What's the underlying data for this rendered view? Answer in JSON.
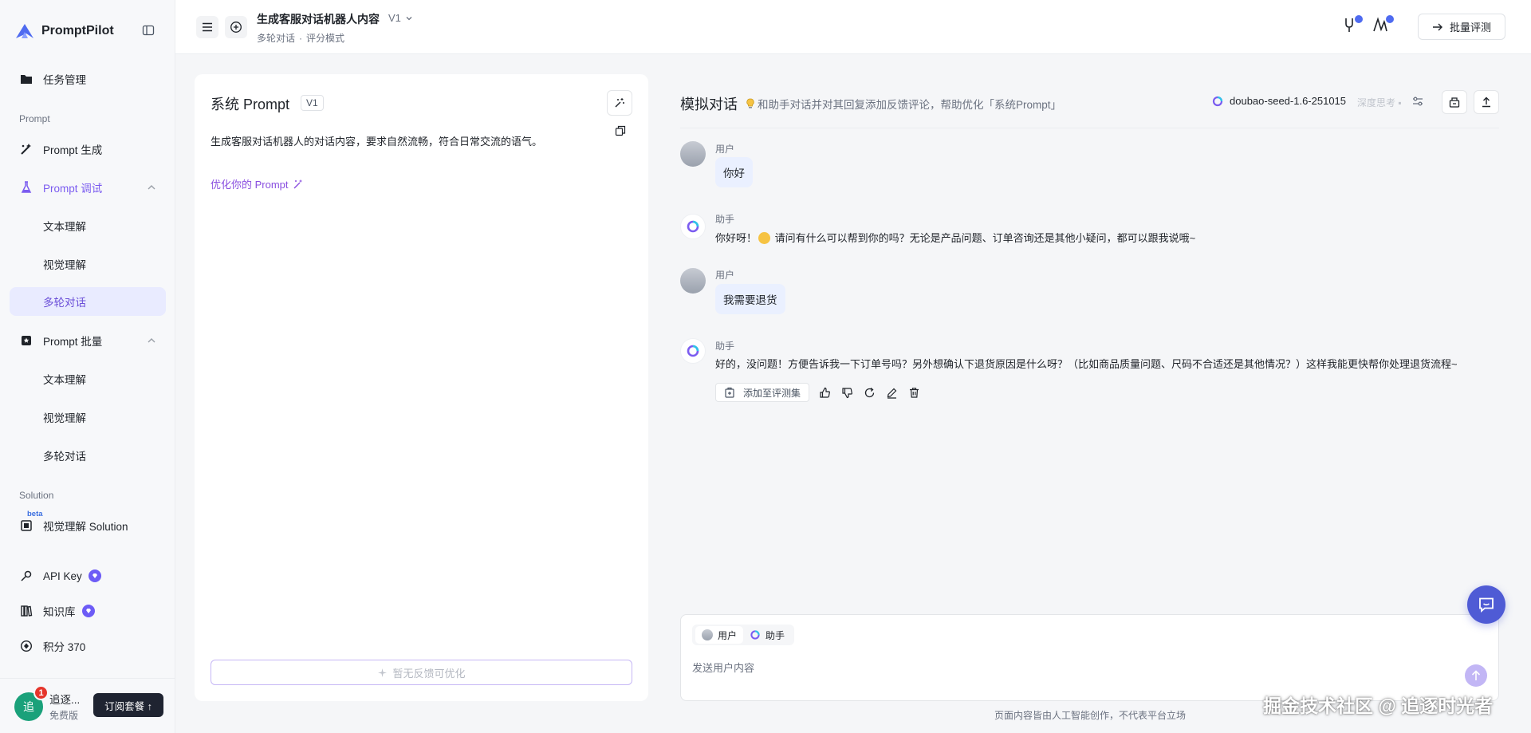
{
  "app": {
    "name": "PromptPilot"
  },
  "sidebar": {
    "task_management": "任务管理",
    "section_prompt": "Prompt",
    "prompt_generate": "Prompt 生成",
    "prompt_debug": "Prompt 调试",
    "debug_items": [
      "文本理解",
      "视觉理解",
      "多轮对话"
    ],
    "prompt_batch": "Prompt 批量",
    "batch_items": [
      "文本理解",
      "视觉理解",
      "多轮对话"
    ],
    "section_solution": "Solution",
    "beta": "beta",
    "visual_solution": "视觉理解 Solution",
    "api_key": "API Key",
    "knowledge_base": "知识库",
    "points": "积分 370",
    "user": {
      "avatar_char": "追",
      "name": "追逐...",
      "plan": "免费版",
      "notifications": "1"
    },
    "subscribe": "订阅套餐 ↑"
  },
  "header": {
    "title": "生成客服对话机器人内容",
    "version": "V1",
    "subtitle_mode": "多轮对话",
    "subtitle_eval": "评分模式",
    "batch_eval": "批量评测"
  },
  "prompt_panel": {
    "title": "系统 Prompt",
    "version": "V1",
    "content": "生成客服对话机器人的对话内容，要求自然流畅，符合日常交流的语气。",
    "optimize_link": "优化你的 Prompt",
    "no_feedback": "暂无反馈可优化"
  },
  "chat": {
    "title": "模拟对话",
    "hint": "和助手对话并对其回复添加反馈评论，帮助优化「系统Prompt」",
    "model": "doubao-seed-1.6-251015",
    "deep_think": "深度思考 ▪",
    "messages": [
      {
        "role": "用户",
        "text": "你好"
      },
      {
        "role": "助手",
        "text_before": "你好呀！",
        "text_after": " 请问有什么可以帮到你的吗？无论是产品问题、订单咨询还是其他小疑问，都可以跟我说哦~"
      },
      {
        "role": "用户",
        "text": "我需要退货"
      },
      {
        "role": "助手",
        "text": "好的，没问题！方便告诉我一下订单号吗？另外想确认下退货原因是什么呀？（比如商品质量问题、尺码不合适还是其他情况？）这样我能更快帮你处理退货流程~"
      }
    ],
    "add_to_eval": "添加至评测集",
    "input": {
      "role_user": "用户",
      "role_assistant": "助手",
      "placeholder": "发送用户内容"
    },
    "footer_note": "页面内容皆由人工智能创作，不代表平台立场"
  },
  "watermark": "掘金技术社区 @ 追逐时光者",
  "colors": {
    "accent": "#7b5cf0",
    "bubble": "#eaf0ff",
    "send": "#c2b6f5",
    "support": "#4f5bd5"
  }
}
